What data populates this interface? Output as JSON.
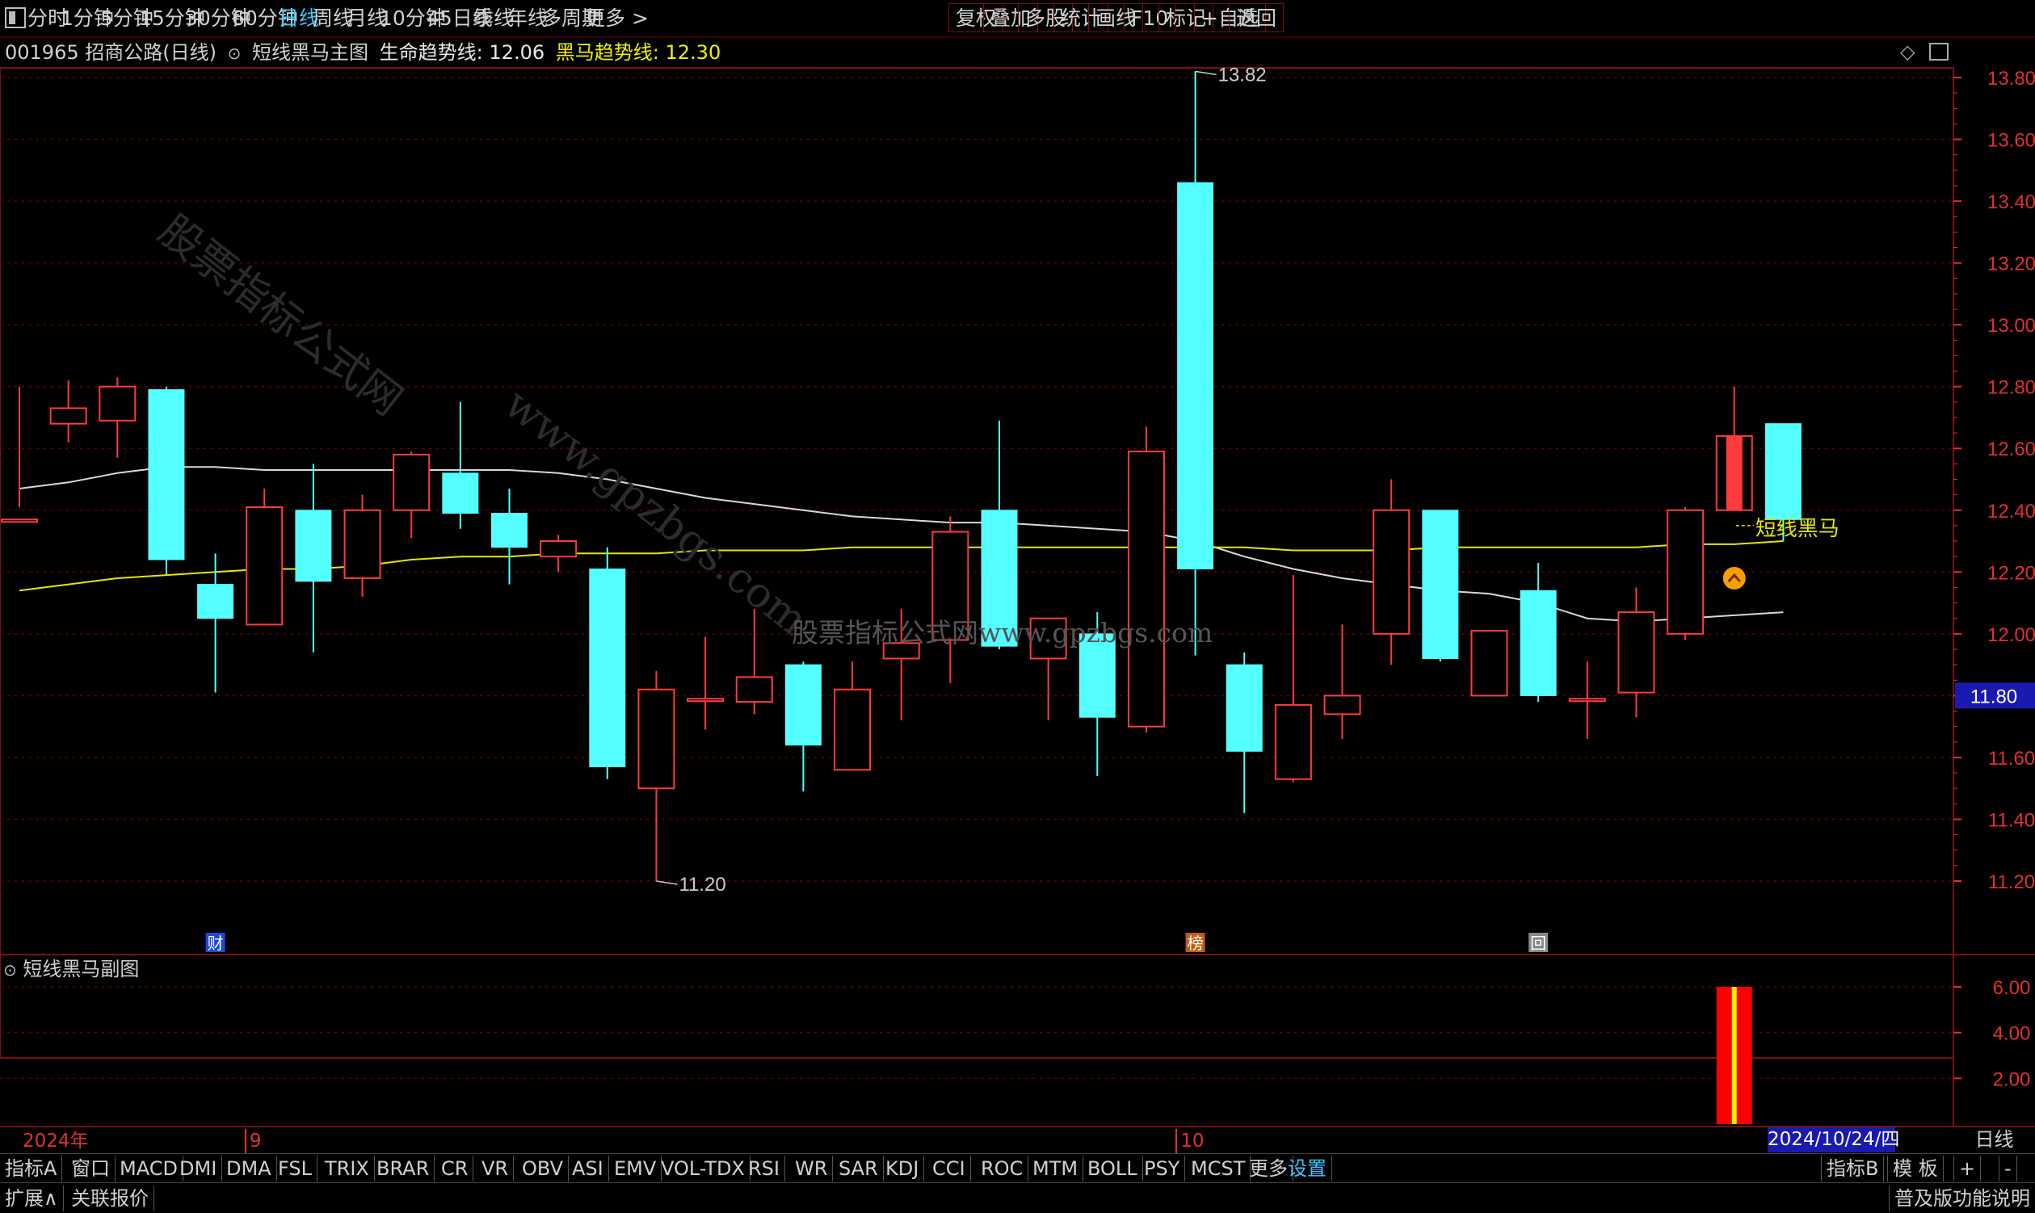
{
  "toolbar": {
    "timeframes": [
      "分时",
      "1分钟",
      "5分钟",
      "15分钟",
      "30分钟",
      "60分钟",
      "日线",
      "周线",
      "月线",
      "10分钟",
      "45日线",
      "季线",
      "年线",
      "多周期",
      "更多 >"
    ],
    "active_timeframe": "日线",
    "right_buttons": [
      "复权",
      "叠加",
      "多股",
      "统计",
      "画线",
      "F10",
      "标记",
      "+自选",
      "返回"
    ]
  },
  "info": {
    "stock": "001965 招商公路(日线)",
    "indicator_name": "短线黑马主图",
    "life_line_label": "生命趋势线:",
    "life_line_value": "12.06",
    "horse_line_label": "黑马趋势线:",
    "horse_line_value": "12.30"
  },
  "chart_data": {
    "type": "candlestick",
    "y_ticks": [
      "13.80",
      "13.60",
      "13.40",
      "13.20",
      "13.00",
      "12.80",
      "12.60",
      "12.40",
      "12.20",
      "12.00",
      "11.80",
      "11.60",
      "11.40",
      "11.20"
    ],
    "ylim": [
      11.12,
      13.86
    ],
    "current_price": "11.80",
    "high_annotation": "13.82",
    "low_annotation": "11.20",
    "candles": [
      {
        "o": 12.37,
        "h": 12.8,
        "l": 12.41,
        "c": 12.37
      },
      {
        "o": 12.68,
        "h": 12.82,
        "l": 12.62,
        "c": 12.73
      },
      {
        "o": 12.69,
        "h": 12.83,
        "l": 12.57,
        "c": 12.8
      },
      {
        "o": 12.79,
        "h": 12.8,
        "l": 12.19,
        "c": 12.24
      },
      {
        "o": 12.16,
        "h": 12.26,
        "l": 11.81,
        "c": 12.05
      },
      {
        "o": 12.03,
        "h": 12.47,
        "l": 12.03,
        "c": 12.41
      },
      {
        "o": 12.4,
        "h": 12.55,
        "l": 11.94,
        "c": 12.17
      },
      {
        "o": 12.18,
        "h": 12.45,
        "l": 12.12,
        "c": 12.4
      },
      {
        "o": 12.4,
        "h": 12.59,
        "l": 12.31,
        "c": 12.58
      },
      {
        "o": 12.52,
        "h": 12.75,
        "l": 12.34,
        "c": 12.39
      },
      {
        "o": 12.39,
        "h": 12.47,
        "l": 12.16,
        "c": 12.28
      },
      {
        "o": 12.25,
        "h": 12.32,
        "l": 12.2,
        "c": 12.3
      },
      {
        "o": 12.21,
        "h": 12.28,
        "l": 11.53,
        "c": 11.57
      },
      {
        "o": 11.5,
        "h": 11.88,
        "l": 11.2,
        "c": 11.82
      },
      {
        "o": 11.79,
        "h": 11.99,
        "l": 11.69,
        "c": 11.79
      },
      {
        "o": 11.78,
        "h": 12.08,
        "l": 11.74,
        "c": 11.86
      },
      {
        "o": 11.9,
        "h": 11.91,
        "l": 11.49,
        "c": 11.64
      },
      {
        "o": 11.56,
        "h": 11.91,
        "l": 11.56,
        "c": 11.82
      },
      {
        "o": 11.92,
        "h": 12.08,
        "l": 11.72,
        "c": 11.97
      },
      {
        "o": 11.98,
        "h": 12.38,
        "l": 11.84,
        "c": 12.33
      },
      {
        "o": 12.4,
        "h": 12.69,
        "l": 11.95,
        "c": 11.96
      },
      {
        "o": 11.92,
        "h": 12.03,
        "l": 11.72,
        "c": 12.05
      },
      {
        "o": 12.0,
        "h": 12.07,
        "l": 11.54,
        "c": 11.73
      },
      {
        "o": 11.7,
        "h": 12.67,
        "l": 11.68,
        "c": 12.59
      },
      {
        "o": 13.46,
        "h": 13.82,
        "l": 11.93,
        "c": 12.21
      },
      {
        "o": 11.9,
        "h": 11.94,
        "l": 11.42,
        "c": 11.62
      },
      {
        "o": 11.53,
        "h": 12.19,
        "l": 11.52,
        "c": 11.77
      },
      {
        "o": 11.74,
        "h": 12.03,
        "l": 11.66,
        "c": 11.8
      },
      {
        "o": 12.0,
        "h": 12.5,
        "l": 11.9,
        "c": 12.4
      },
      {
        "o": 12.4,
        "h": 12.4,
        "l": 11.91,
        "c": 11.92
      },
      {
        "o": 11.8,
        "h": 12.0,
        "l": 11.8,
        "c": 12.01
      },
      {
        "o": 12.14,
        "h": 12.23,
        "l": 11.78,
        "c": 11.8
      },
      {
        "o": 11.79,
        "h": 11.91,
        "l": 11.66,
        "c": 11.79
      },
      {
        "o": 11.81,
        "h": 12.15,
        "l": 11.73,
        "c": 12.07
      },
      {
        "o": 12.0,
        "h": 12.41,
        "l": 11.98,
        "c": 12.4
      },
      {
        "o": 12.4,
        "h": 12.8,
        "l": 12.4,
        "c": 12.64
      },
      {
        "o": 12.68,
        "h": 12.68,
        "l": 12.3,
        "c": 12.37
      }
    ],
    "life_line": [
      12.47,
      12.49,
      12.52,
      12.54,
      12.54,
      12.53,
      12.53,
      12.53,
      12.53,
      12.53,
      12.53,
      12.52,
      12.5,
      12.47,
      12.44,
      12.42,
      12.4,
      12.38,
      12.37,
      12.36,
      12.36,
      12.35,
      12.34,
      12.33,
      12.3,
      12.25,
      12.21,
      12.18,
      12.16,
      12.14,
      12.13,
      12.1,
      12.05,
      12.04,
      12.05,
      12.06,
      12.07
    ],
    "horse_line": [
      12.14,
      12.16,
      12.18,
      12.19,
      12.2,
      12.21,
      12.21,
      12.22,
      12.24,
      12.25,
      12.25,
      12.26,
      12.26,
      12.26,
      12.27,
      12.27,
      12.27,
      12.28,
      12.28,
      12.28,
      12.28,
      12.28,
      12.28,
      12.28,
      12.28,
      12.28,
      12.27,
      12.27,
      12.27,
      12.28,
      12.28,
      12.28,
      12.28,
      12.28,
      12.29,
      12.29,
      12.3
    ],
    "signal_label": "短线黑马",
    "event_markers": [
      {
        "index": 4,
        "text": "财"
      },
      {
        "index": 24,
        "text": "榜"
      },
      {
        "index": 31,
        "text": "回"
      }
    ],
    "sub_indicator": {
      "name": "短线黑马副图",
      "y_ticks": [
        "6.00",
        "4.00",
        "2.00"
      ],
      "bars": [
        {
          "index": 35,
          "value": 6.0
        }
      ]
    },
    "x_labels": [
      {
        "index": 0,
        "text": "2024年"
      },
      {
        "index": 5,
        "text": "9"
      },
      {
        "index": 24,
        "text": "10"
      }
    ],
    "cursor_date": "2024/10/24/四",
    "period_label": "日线"
  },
  "watermarks": [
    "股票指标公式网",
    "www.gpzbgs.com",
    "股票指标公式网www.gpzbgs.com"
  ],
  "bottom_tabs": [
    "指标A",
    "窗口",
    "MACD",
    "DMI",
    "DMA",
    "FSL",
    "TRIX",
    "BRAR",
    "CR",
    "VR",
    "OBV",
    "ASI",
    "EMV",
    "VOL-TDX",
    "RSI",
    "WR",
    "SAR",
    "KDJ",
    "CCI",
    "ROC",
    "MTM",
    "BOLL",
    "PSY",
    "MCST",
    "更多",
    "设置"
  ],
  "bottom_right_tabs": [
    "指标B",
    "模 板",
    "+",
    "-"
  ],
  "status": {
    "expand": "扩展∧",
    "linked_quote": "关联报价",
    "version_note": "普及版功能说明"
  },
  "colors": {
    "up": "#ff3b3b",
    "down": "#54ffff",
    "grid": "#6a0000",
    "life_line": "#d8d8d8",
    "horse_line": "#e6e600",
    "accent": "#39c7ff"
  }
}
